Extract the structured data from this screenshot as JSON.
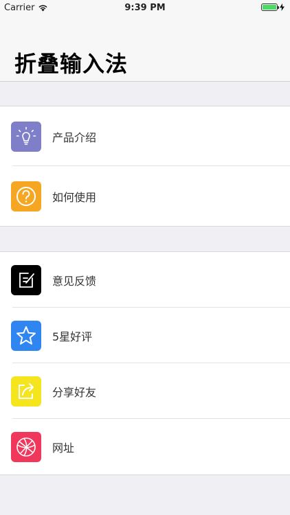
{
  "status_bar": {
    "carrier": "Carrier",
    "time": "9:39 PM"
  },
  "nav": {
    "title": "折叠输入法"
  },
  "groups": [
    {
      "items": [
        {
          "label": "产品介绍",
          "icon": "lightbulb-icon",
          "color": "#7f7fc9"
        },
        {
          "label": "如何使用",
          "icon": "question-icon",
          "color": "#f5a623"
        }
      ]
    },
    {
      "items": [
        {
          "label": "意见反馈",
          "icon": "feedback-icon",
          "color": "#000000"
        },
        {
          "label": "5星好评",
          "icon": "star-icon",
          "color": "#2f86f0"
        },
        {
          "label": "分享好友",
          "icon": "share-icon",
          "color": "#f4e51e"
        },
        {
          "label": "网址",
          "icon": "globe-icon",
          "color": "#f0385c"
        }
      ]
    }
  ]
}
